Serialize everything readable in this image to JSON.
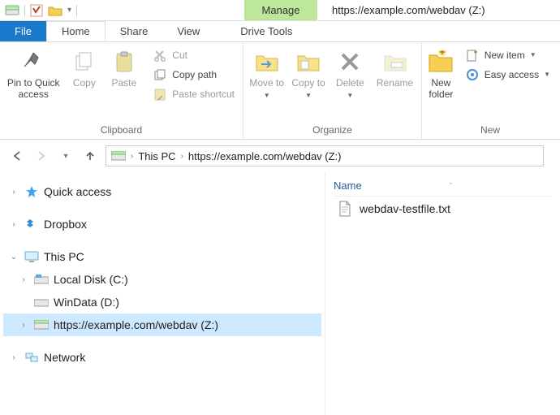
{
  "window": {
    "title": "https://example.com/webdav (Z:)",
    "context_tab": "Manage"
  },
  "tabs": {
    "file": "File",
    "home": "Home",
    "share": "Share",
    "view": "View",
    "drive_tools": "Drive Tools"
  },
  "ribbon": {
    "clipboard": {
      "label": "Clipboard",
      "pin": "Pin to Quick access",
      "copy": "Copy",
      "paste": "Paste",
      "cut": "Cut",
      "copy_path": "Copy path",
      "paste_shortcut": "Paste shortcut"
    },
    "organize": {
      "label": "Organize",
      "move_to": "Move to",
      "copy_to": "Copy to",
      "delete": "Delete",
      "rename": "Rename"
    },
    "new": {
      "label": "New",
      "new_folder": "New folder",
      "new_item": "New item",
      "easy_access": "Easy access"
    }
  },
  "breadcrumb": {
    "root": "This PC",
    "current": "https://example.com/webdav (Z:)"
  },
  "navpane": {
    "quick_access": "Quick access",
    "dropbox": "Dropbox",
    "this_pc": "This PC",
    "local_disk": "Local Disk (C:)",
    "windata": "WinData (D:)",
    "webdav": "https://example.com/webdav (Z:)",
    "network": "Network"
  },
  "content": {
    "column_name": "Name",
    "files": [
      {
        "name": "webdav-testfile.txt"
      }
    ]
  }
}
